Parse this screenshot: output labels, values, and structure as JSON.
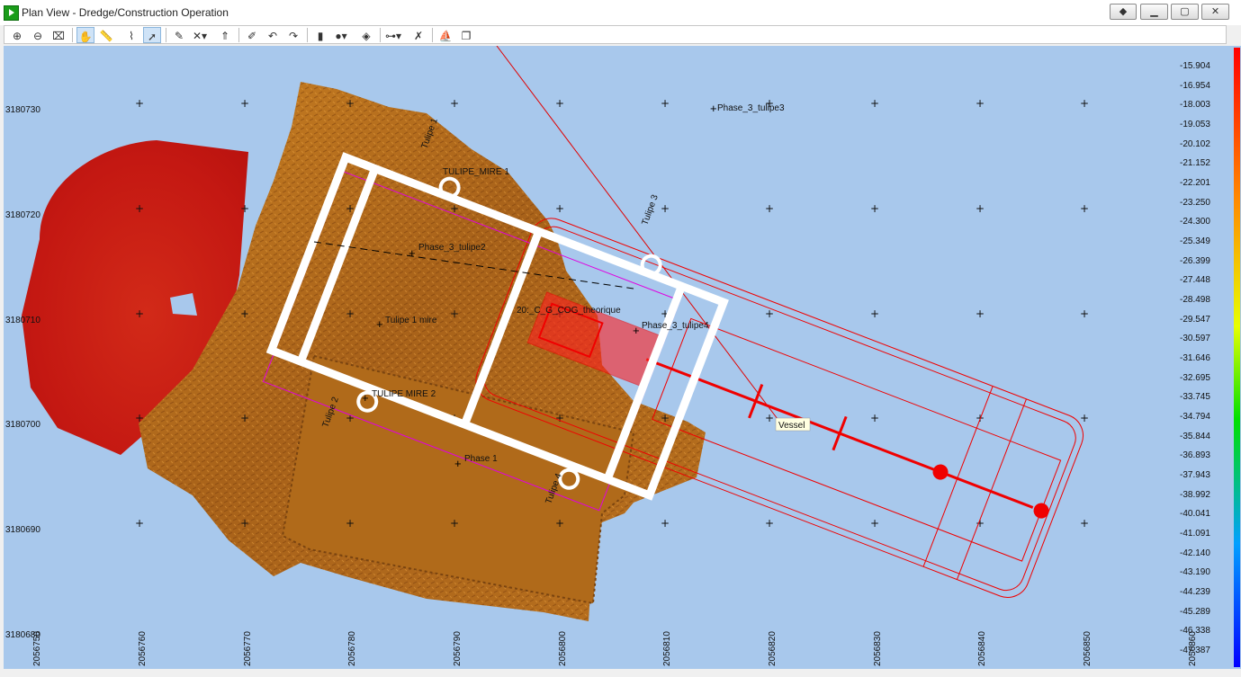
{
  "window": {
    "title": "Plan View - Dredge/Construction Operation",
    "caption_buttons": [
      "pin",
      "minimize",
      "maximize",
      "close"
    ]
  },
  "toolbar": {
    "tools": [
      {
        "name": "zoom-in",
        "glyph": "⊕"
      },
      {
        "name": "zoom-out",
        "glyph": "⊖"
      },
      {
        "name": "zoom-window",
        "glyph": "⌧"
      },
      {
        "name": "pan",
        "glyph": "✋",
        "active": true
      },
      {
        "name": "measure",
        "glyph": "📏"
      },
      {
        "name": "profile",
        "glyph": "⌇"
      },
      {
        "name": "select",
        "glyph": "➚",
        "active": true
      },
      {
        "name": "draw-line",
        "glyph": "✎"
      },
      {
        "name": "waypoint-menu",
        "glyph": "✕▾"
      },
      {
        "name": "north-up",
        "glyph": "⇑"
      },
      {
        "name": "edit",
        "glyph": "✐"
      },
      {
        "name": "undo",
        "glyph": "↶"
      },
      {
        "name": "redo",
        "glyph": "↷"
      },
      {
        "name": "color-scale",
        "glyph": "▮"
      },
      {
        "name": "color-palette-menu",
        "glyph": "●▾"
      },
      {
        "name": "shading",
        "glyph": "◈"
      },
      {
        "name": "view-options-menu",
        "glyph": "⊶▾"
      },
      {
        "name": "delete",
        "glyph": "✗"
      },
      {
        "name": "vessel-view",
        "glyph": "⛵"
      },
      {
        "name": "new-window",
        "glyph": "❐"
      }
    ]
  },
  "map": {
    "y_axis_labels": [
      "3180730",
      "3180720",
      "3180710",
      "3180700",
      "3180690",
      "3180680"
    ],
    "x_axis_labels": [
      "2056750",
      "2056760",
      "2056770",
      "2056780",
      "2056790",
      "2056800",
      "2056810",
      "2056820",
      "2056830",
      "2056840",
      "2056850",
      "2056860"
    ],
    "labels": {
      "phase3_tulipe3": "Phase_3_tulipe3",
      "tulipe1": "Tulipe 1",
      "tulipe_mire1": "TULIPE_MIRE 1",
      "tulipe3": "Tulipe 3",
      "phase3_tulipe2": "Phase_3_tulipe2",
      "cog": "20:_C_G_COG_theorique",
      "tulipe1_mire": "Tulipe 1 mire",
      "phase3_tulipe4": "Phase_3_tulipe4",
      "tulipe_mire2": "TULIPE MIRE 2",
      "tulipe2": "Tulipe 2",
      "vessel": "Vessel",
      "phase1": "Phase 1",
      "tulipe4": "Tulipe 4"
    },
    "colors": {
      "water": "#a8c8ec",
      "vessel_outline": "#ff0000",
      "frame": "#ffffff",
      "seabed": "#b8701e",
      "deep_area": "#cc1a14"
    }
  },
  "legend": {
    "depths": [
      "-15.904",
      "-16.954",
      "-18.003",
      "-19.053",
      "-20.102",
      "-21.152",
      "-22.201",
      "-23.250",
      "-24.300",
      "-25.349",
      "-26.399",
      "-27.448",
      "-28.498",
      "-29.547",
      "-30.597",
      "-31.646",
      "-32.695",
      "-33.745",
      "-34.794",
      "-35.844",
      "-36.893",
      "-37.943",
      "-38.992",
      "-40.041",
      "-41.091",
      "-42.140",
      "-43.190",
      "-44.239",
      "-45.289",
      "-46.338",
      "-47.387"
    ],
    "colors": [
      "#ff0000",
      "#ff8c00",
      "#e8ff00",
      "#00e000",
      "#00a0ff",
      "#0000ff"
    ]
  }
}
